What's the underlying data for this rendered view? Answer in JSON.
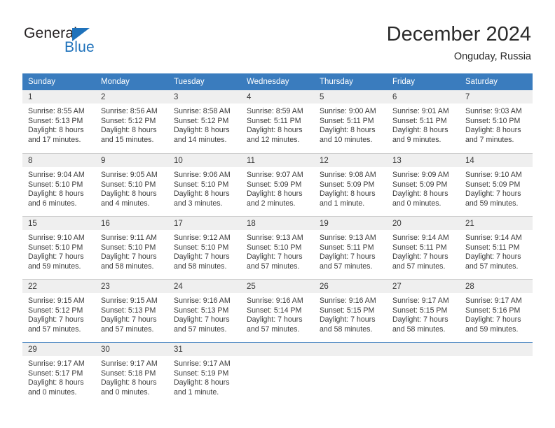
{
  "brand": {
    "name_part1": "General",
    "name_part2": "Blue",
    "triangle_color": "#1f72bb"
  },
  "header": {
    "title": "December 2024",
    "location": "Onguday, Russia"
  },
  "theme": {
    "header_row_bg": "#3a7cbe",
    "daynum_band_bg": "#efefef",
    "text_color": "#3a3a3a",
    "rule_color": "#d0d0d0"
  },
  "weekday_headers": [
    "Sunday",
    "Monday",
    "Tuesday",
    "Wednesday",
    "Thursday",
    "Friday",
    "Saturday"
  ],
  "weeks": [
    [
      {
        "day": "1",
        "sunrise": "Sunrise: 8:55 AM",
        "sunset": "Sunset: 5:13 PM",
        "daylight1": "Daylight: 8 hours",
        "daylight2": "and 17 minutes."
      },
      {
        "day": "2",
        "sunrise": "Sunrise: 8:56 AM",
        "sunset": "Sunset: 5:12 PM",
        "daylight1": "Daylight: 8 hours",
        "daylight2": "and 15 minutes."
      },
      {
        "day": "3",
        "sunrise": "Sunrise: 8:58 AM",
        "sunset": "Sunset: 5:12 PM",
        "daylight1": "Daylight: 8 hours",
        "daylight2": "and 14 minutes."
      },
      {
        "day": "4",
        "sunrise": "Sunrise: 8:59 AM",
        "sunset": "Sunset: 5:11 PM",
        "daylight1": "Daylight: 8 hours",
        "daylight2": "and 12 minutes."
      },
      {
        "day": "5",
        "sunrise": "Sunrise: 9:00 AM",
        "sunset": "Sunset: 5:11 PM",
        "daylight1": "Daylight: 8 hours",
        "daylight2": "and 10 minutes."
      },
      {
        "day": "6",
        "sunrise": "Sunrise: 9:01 AM",
        "sunset": "Sunset: 5:11 PM",
        "daylight1": "Daylight: 8 hours",
        "daylight2": "and 9 minutes."
      },
      {
        "day": "7",
        "sunrise": "Sunrise: 9:03 AM",
        "sunset": "Sunset: 5:10 PM",
        "daylight1": "Daylight: 8 hours",
        "daylight2": "and 7 minutes."
      }
    ],
    [
      {
        "day": "8",
        "sunrise": "Sunrise: 9:04 AM",
        "sunset": "Sunset: 5:10 PM",
        "daylight1": "Daylight: 8 hours",
        "daylight2": "and 6 minutes."
      },
      {
        "day": "9",
        "sunrise": "Sunrise: 9:05 AM",
        "sunset": "Sunset: 5:10 PM",
        "daylight1": "Daylight: 8 hours",
        "daylight2": "and 4 minutes."
      },
      {
        "day": "10",
        "sunrise": "Sunrise: 9:06 AM",
        "sunset": "Sunset: 5:10 PM",
        "daylight1": "Daylight: 8 hours",
        "daylight2": "and 3 minutes."
      },
      {
        "day": "11",
        "sunrise": "Sunrise: 9:07 AM",
        "sunset": "Sunset: 5:09 PM",
        "daylight1": "Daylight: 8 hours",
        "daylight2": "and 2 minutes."
      },
      {
        "day": "12",
        "sunrise": "Sunrise: 9:08 AM",
        "sunset": "Sunset: 5:09 PM",
        "daylight1": "Daylight: 8 hours",
        "daylight2": "and 1 minute."
      },
      {
        "day": "13",
        "sunrise": "Sunrise: 9:09 AM",
        "sunset": "Sunset: 5:09 PM",
        "daylight1": "Daylight: 8 hours",
        "daylight2": "and 0 minutes."
      },
      {
        "day": "14",
        "sunrise": "Sunrise: 9:10 AM",
        "sunset": "Sunset: 5:09 PM",
        "daylight1": "Daylight: 7 hours",
        "daylight2": "and 59 minutes."
      }
    ],
    [
      {
        "day": "15",
        "sunrise": "Sunrise: 9:10 AM",
        "sunset": "Sunset: 5:10 PM",
        "daylight1": "Daylight: 7 hours",
        "daylight2": "and 59 minutes."
      },
      {
        "day": "16",
        "sunrise": "Sunrise: 9:11 AM",
        "sunset": "Sunset: 5:10 PM",
        "daylight1": "Daylight: 7 hours",
        "daylight2": "and 58 minutes."
      },
      {
        "day": "17",
        "sunrise": "Sunrise: 9:12 AM",
        "sunset": "Sunset: 5:10 PM",
        "daylight1": "Daylight: 7 hours",
        "daylight2": "and 58 minutes."
      },
      {
        "day": "18",
        "sunrise": "Sunrise: 9:13 AM",
        "sunset": "Sunset: 5:10 PM",
        "daylight1": "Daylight: 7 hours",
        "daylight2": "and 57 minutes."
      },
      {
        "day": "19",
        "sunrise": "Sunrise: 9:13 AM",
        "sunset": "Sunset: 5:11 PM",
        "daylight1": "Daylight: 7 hours",
        "daylight2": "and 57 minutes."
      },
      {
        "day": "20",
        "sunrise": "Sunrise: 9:14 AM",
        "sunset": "Sunset: 5:11 PM",
        "daylight1": "Daylight: 7 hours",
        "daylight2": "and 57 minutes."
      },
      {
        "day": "21",
        "sunrise": "Sunrise: 9:14 AM",
        "sunset": "Sunset: 5:11 PM",
        "daylight1": "Daylight: 7 hours",
        "daylight2": "and 57 minutes."
      }
    ],
    [
      {
        "day": "22",
        "sunrise": "Sunrise: 9:15 AM",
        "sunset": "Sunset: 5:12 PM",
        "daylight1": "Daylight: 7 hours",
        "daylight2": "and 57 minutes."
      },
      {
        "day": "23",
        "sunrise": "Sunrise: 9:15 AM",
        "sunset": "Sunset: 5:13 PM",
        "daylight1": "Daylight: 7 hours",
        "daylight2": "and 57 minutes."
      },
      {
        "day": "24",
        "sunrise": "Sunrise: 9:16 AM",
        "sunset": "Sunset: 5:13 PM",
        "daylight1": "Daylight: 7 hours",
        "daylight2": "and 57 minutes."
      },
      {
        "day": "25",
        "sunrise": "Sunrise: 9:16 AM",
        "sunset": "Sunset: 5:14 PM",
        "daylight1": "Daylight: 7 hours",
        "daylight2": "and 57 minutes."
      },
      {
        "day": "26",
        "sunrise": "Sunrise: 9:16 AM",
        "sunset": "Sunset: 5:15 PM",
        "daylight1": "Daylight: 7 hours",
        "daylight2": "and 58 minutes."
      },
      {
        "day": "27",
        "sunrise": "Sunrise: 9:17 AM",
        "sunset": "Sunset: 5:15 PM",
        "daylight1": "Daylight: 7 hours",
        "daylight2": "and 58 minutes."
      },
      {
        "day": "28",
        "sunrise": "Sunrise: 9:17 AM",
        "sunset": "Sunset: 5:16 PM",
        "daylight1": "Daylight: 7 hours",
        "daylight2": "and 59 minutes."
      }
    ],
    [
      {
        "day": "29",
        "sunrise": "Sunrise: 9:17 AM",
        "sunset": "Sunset: 5:17 PM",
        "daylight1": "Daylight: 8 hours",
        "daylight2": "and 0 minutes."
      },
      {
        "day": "30",
        "sunrise": "Sunrise: 9:17 AM",
        "sunset": "Sunset: 5:18 PM",
        "daylight1": "Daylight: 8 hours",
        "daylight2": "and 0 minutes."
      },
      {
        "day": "31",
        "sunrise": "Sunrise: 9:17 AM",
        "sunset": "Sunset: 5:19 PM",
        "daylight1": "Daylight: 8 hours",
        "daylight2": "and 1 minute."
      },
      {
        "day": "",
        "sunrise": "",
        "sunset": "",
        "daylight1": "",
        "daylight2": ""
      },
      {
        "day": "",
        "sunrise": "",
        "sunset": "",
        "daylight1": "",
        "daylight2": ""
      },
      {
        "day": "",
        "sunrise": "",
        "sunset": "",
        "daylight1": "",
        "daylight2": ""
      },
      {
        "day": "",
        "sunrise": "",
        "sunset": "",
        "daylight1": "",
        "daylight2": ""
      }
    ]
  ]
}
